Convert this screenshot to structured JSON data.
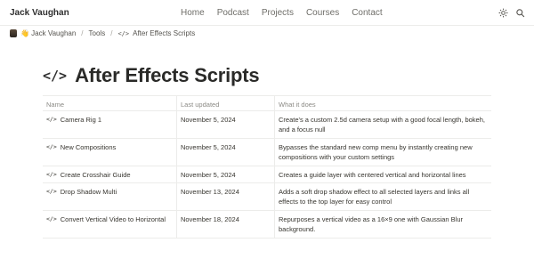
{
  "site": {
    "name": "Jack Vaughan",
    "nav": [
      "Home",
      "Podcast",
      "Projects",
      "Courses",
      "Contact"
    ],
    "icons": [
      "theme-toggle-icon",
      "search-icon"
    ]
  },
  "breadcrumb": {
    "items": [
      "👋 Jack Vaughan",
      "Tools",
      "After Effects Scripts"
    ],
    "separator": "/",
    "code_glyph": "</>"
  },
  "page": {
    "title": "After Effects Scripts",
    "title_icon": "</>"
  },
  "table": {
    "columns": [
      "Name",
      "Last updated",
      "What it does"
    ],
    "rows": [
      {
        "name": "Camera Rig 1",
        "updated": "November 5, 2024",
        "desc": "Create's a custom 2.5d camera setup with a good focal length, bokeh, and a focus null"
      },
      {
        "name": "New Compositions",
        "updated": "November 5, 2024",
        "desc": "Bypasses the standard new comp menu by instantly creating new compositions with your custom settings"
      },
      {
        "name": "Create Crosshair Guide",
        "updated": "November 5, 2024",
        "desc": "Creates a guide layer with centered vertical and horizontal lines"
      },
      {
        "name": "Drop Shadow Multi",
        "updated": "November 13, 2024",
        "desc": "Adds a soft drop shadow effect to all selected layers and links all effects to the top layer for easy control"
      },
      {
        "name": "Convert Vertical Video to Horizontal",
        "updated": "November 18, 2024",
        "desc": "Repurposes a vertical video as a 16×9 one with Gaussian Blur background."
      }
    ],
    "row_icon": "</>"
  }
}
